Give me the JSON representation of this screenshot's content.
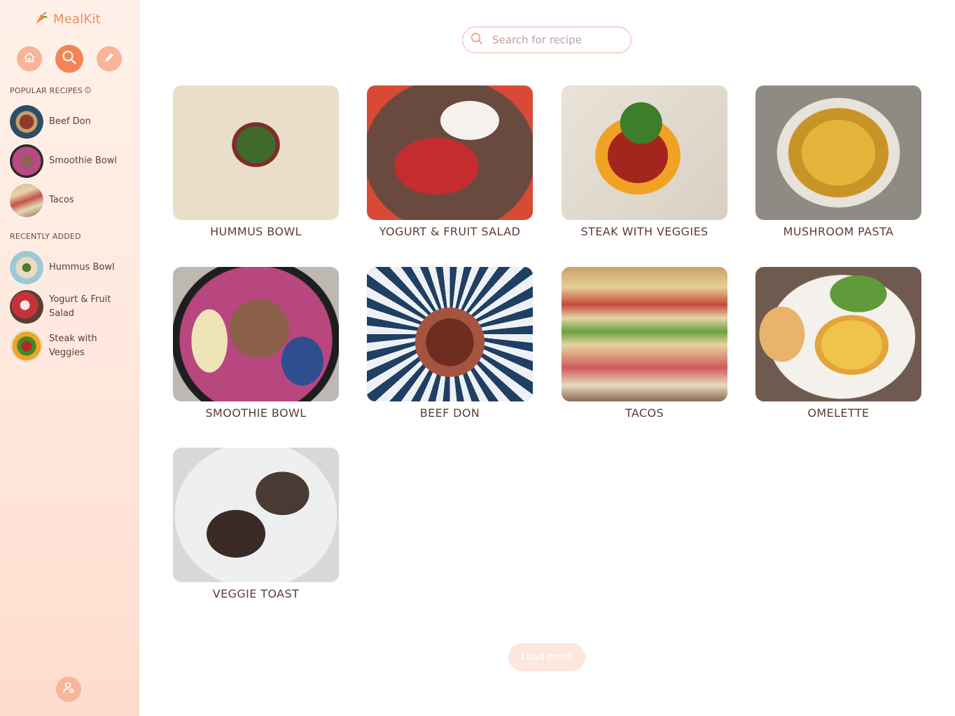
{
  "app": {
    "name": "MealKit"
  },
  "sidebar": {
    "popular_title": "POPULAR RECIPES",
    "popular": [
      {
        "label": "Beef Don"
      },
      {
        "label": "Smoothie Bowl"
      },
      {
        "label": "Tacos"
      }
    ],
    "recent_title": "RECENTLY ADDED",
    "recent": [
      {
        "label": "Hummus Bowl"
      },
      {
        "label": "Yogurt & Fruit Salad"
      },
      {
        "label": "Steak with Veggies"
      }
    ]
  },
  "search": {
    "placeholder": "Search for recipe",
    "value": ""
  },
  "recipes": [
    {
      "title": "HUMMUS BOWL"
    },
    {
      "title": "YOGURT & FRUIT SALAD"
    },
    {
      "title": "STEAK WITH VEGGIES"
    },
    {
      "title": "MUSHROOM PASTA"
    },
    {
      "title": "SMOOTHIE BOWL"
    },
    {
      "title": "BEEF DON"
    },
    {
      "title": "TACOS"
    },
    {
      "title": "OMELETTE"
    },
    {
      "title": "VEGGIE TOAST"
    }
  ],
  "load_more": "Load more",
  "colors": {
    "accent": "#f28457",
    "accent_light": "#f9b597",
    "text": "#5a3e33"
  }
}
